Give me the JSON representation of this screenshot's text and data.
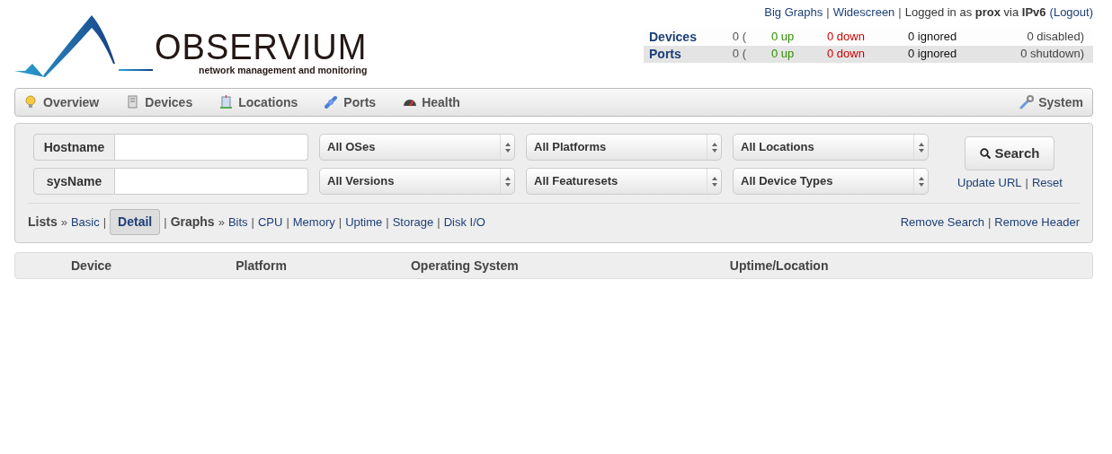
{
  "logo": {
    "name": "OBSERVIUM",
    "tagline": "network management and monitoring"
  },
  "top_bar": [
    {
      "kind": "link",
      "text": "Big Graphs"
    },
    {
      "kind": "sep",
      "text": "|"
    },
    {
      "kind": "link",
      "text": "Widescreen"
    },
    {
      "kind": "sep",
      "text": "|"
    },
    {
      "kind": "text",
      "text": "Logged in as **prox** via **IPv6**"
    },
    {
      "kind": "link",
      "text": "(Logout)"
    }
  ],
  "status_rows": [
    {
      "label": "Devices",
      "total": "0 (",
      "up": "0 up",
      "down": "0 down",
      "ignored": "0 ignored",
      "last": "0 disabled)",
      "shaded": false
    },
    {
      "label": "Ports",
      "total": "0 (",
      "up": "0 up",
      "down": "0 down",
      "ignored": "0 ignored",
      "last": "0 shutdown)",
      "shaded": true
    }
  ],
  "nav": {
    "items": [
      {
        "label": "Overview"
      },
      {
        "label": "Devices"
      },
      {
        "label": "Locations"
      },
      {
        "label": "Ports"
      },
      {
        "label": "Health"
      }
    ],
    "right": [
      {
        "label": "System"
      }
    ]
  },
  "search": {
    "rows": [
      {
        "field_label": "Hostname",
        "selects": [
          "All OSes",
          "All Platforms",
          "All Locations"
        ]
      },
      {
        "field_label": "sysName",
        "selects": [
          "All Versions",
          "All Featuresets",
          "All Device Types"
        ]
      }
    ],
    "button": "Search",
    "links": [
      {
        "kind": "link",
        "text": "Update URL"
      },
      {
        "kind": "sep",
        "text": "|"
      },
      {
        "kind": "link",
        "text": "Reset"
      }
    ]
  },
  "views": [
    {
      "kind": "heading",
      "text": "Lists"
    },
    {
      "kind": "sep",
      "text": "»"
    },
    {
      "kind": "link",
      "text": "Basic",
      "selected": false
    },
    {
      "kind": "sep",
      "text": "|"
    },
    {
      "kind": "link",
      "text": "Detail",
      "selected": true
    },
    {
      "kind": "sep",
      "text": "|"
    },
    {
      "kind": "heading",
      "text": "Graphs"
    },
    {
      "kind": "sep",
      "text": "»"
    },
    {
      "kind": "link",
      "text": "Bits",
      "selected": false
    },
    {
      "kind": "sep",
      "text": "|"
    },
    {
      "kind": "link",
      "text": "CPU",
      "selected": false
    },
    {
      "kind": "sep",
      "text": "|"
    },
    {
      "kind": "link",
      "text": "Memory",
      "selected": false
    },
    {
      "kind": "sep",
      "text": "|"
    },
    {
      "kind": "link",
      "text": "Uptime",
      "selected": false
    },
    {
      "kind": "sep",
      "text": "|"
    },
    {
      "kind": "link",
      "text": "Storage",
      "selected": false
    },
    {
      "kind": "sep",
      "text": "|"
    },
    {
      "kind": "link",
      "text": "Disk I/O",
      "selected": false
    }
  ],
  "view_actions": [
    {
      "kind": "link",
      "text": "Remove Search"
    },
    {
      "kind": "sep",
      "text": "|"
    },
    {
      "kind": "link",
      "text": "Remove Header"
    }
  ],
  "table": {
    "columns": [
      "Device",
      "Platform",
      "Operating System",
      "Uptime/Location"
    ]
  }
}
